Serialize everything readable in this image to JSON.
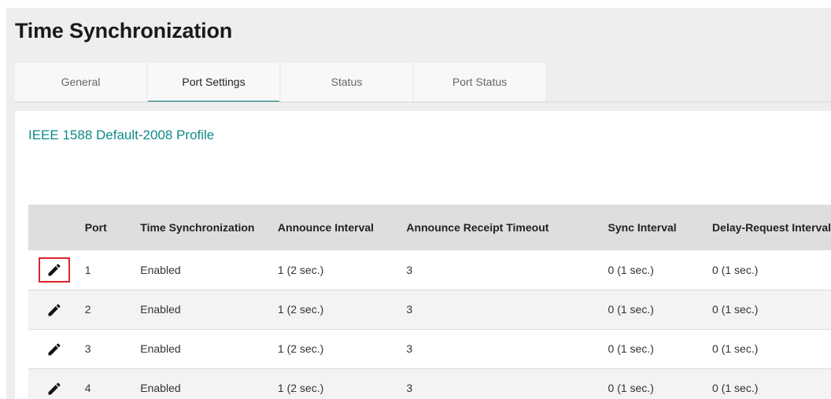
{
  "page": {
    "title": "Time Synchronization"
  },
  "tabs": [
    {
      "label": "General",
      "active": false
    },
    {
      "label": "Port Settings",
      "active": true
    },
    {
      "label": "Status",
      "active": false
    },
    {
      "label": "Port Status",
      "active": false
    }
  ],
  "profile": {
    "name": "IEEE 1588 Default-2008 Profile"
  },
  "table": {
    "columns": [
      "",
      "Port",
      "Time Synchronization",
      "Announce Interval",
      "Announce Receipt Timeout",
      "Sync Interval",
      "Delay-Request Interval"
    ],
    "rows": [
      {
        "port": "1",
        "time_sync": "Enabled",
        "announce_interval": "1 (2 sec.)",
        "announce_receipt_timeout": "3",
        "sync_interval": "0 (1 sec.)",
        "delay_request_interval": "0 (1 sec.)"
      },
      {
        "port": "2",
        "time_sync": "Enabled",
        "announce_interval": "1 (2 sec.)",
        "announce_receipt_timeout": "3",
        "sync_interval": "0 (1 sec.)",
        "delay_request_interval": "0 (1 sec.)"
      },
      {
        "port": "3",
        "time_sync": "Enabled",
        "announce_interval": "1 (2 sec.)",
        "announce_receipt_timeout": "3",
        "sync_interval": "0 (1 sec.)",
        "delay_request_interval": "0 (1 sec.)"
      },
      {
        "port": "4",
        "time_sync": "Enabled",
        "announce_interval": "1 (2 sec.)",
        "announce_receipt_timeout": "3",
        "sync_interval": "0 (1 sec.)",
        "delay_request_interval": "0 (1 sec.)"
      }
    ]
  },
  "icons": {
    "edit": "pencil-icon"
  },
  "colors": {
    "accent": "#007a7a",
    "profile_text": "#0e8a8a",
    "highlight": "#d9262b"
  }
}
